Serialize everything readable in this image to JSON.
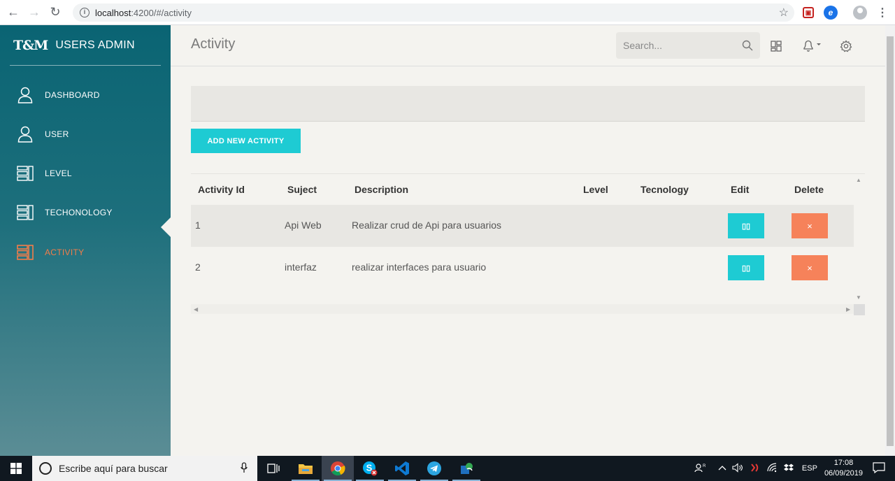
{
  "browser": {
    "url_host": "localhost",
    "url_path": ":4200/#/activity",
    "info_glyph": "i",
    "star_glyph": "☆",
    "back_glyph": "←",
    "forward_glyph": "→",
    "reload_glyph": "↻",
    "menu_glyph": "⋮",
    "ext_shield_glyph": "▣",
    "ext_edge_glyph": "e"
  },
  "sidebar": {
    "logo": "T&M",
    "title": "USERS ADMIN",
    "items": [
      {
        "label": "DASHBOARD",
        "icon": "user-icon"
      },
      {
        "label": "USER",
        "icon": "user-icon"
      },
      {
        "label": "LEVEL",
        "icon": "bars-icon"
      },
      {
        "label": "TECHONOLOGY",
        "icon": "bars-icon"
      },
      {
        "label": "ACTIVITY",
        "icon": "bars-icon",
        "active": true
      }
    ]
  },
  "header": {
    "title": "Activity",
    "search_placeholder": "Search..."
  },
  "actions": {
    "add_label": "ADD NEW ACTIVITY"
  },
  "table": {
    "columns": [
      "Activity Id",
      "Suject",
      "Description",
      "Level",
      "Tecnology",
      "Edit",
      "Delete"
    ],
    "rows": [
      {
        "id": "1",
        "subject": "Api Web",
        "description": "Realizar crud de Api para usuarios",
        "level": "",
        "technology": "",
        "edit_glyph": "▯▯",
        "delete_glyph": "×"
      },
      {
        "id": "2",
        "subject": "interfaz",
        "description": "realizar interfaces para usuario",
        "level": "",
        "technology": "",
        "edit_glyph": "▯▯",
        "delete_glyph": "×"
      }
    ]
  },
  "taskbar": {
    "search_placeholder": "Escribe aquí para buscar",
    "language": "ESP",
    "time": "17:08",
    "date": "06/09/2019"
  },
  "colors": {
    "accent_cyan": "#1ecbd3",
    "accent_orange": "#f6825a",
    "sidebar_top": "#0a6473",
    "active_menu": "#f27d4a"
  }
}
